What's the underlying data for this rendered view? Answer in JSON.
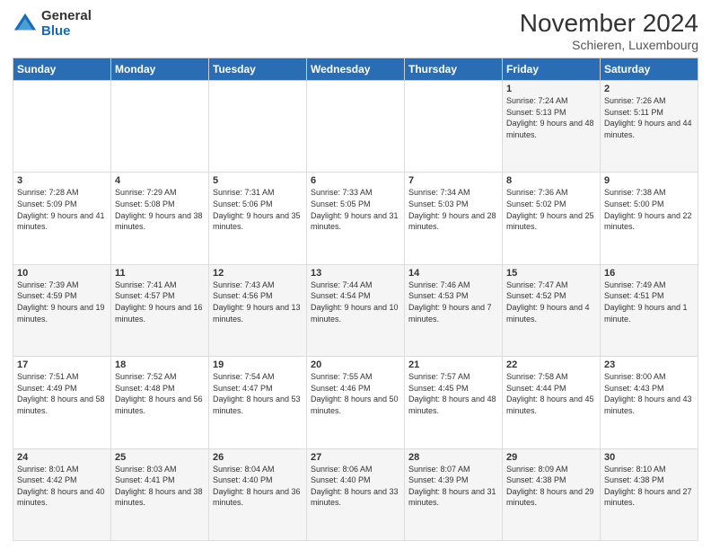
{
  "logo": {
    "general": "General",
    "blue": "Blue"
  },
  "header": {
    "title": "November 2024",
    "location": "Schieren, Luxembourg"
  },
  "days_of_week": [
    "Sunday",
    "Monday",
    "Tuesday",
    "Wednesday",
    "Thursday",
    "Friday",
    "Saturday"
  ],
  "weeks": [
    [
      {
        "day": "",
        "info": ""
      },
      {
        "day": "",
        "info": ""
      },
      {
        "day": "",
        "info": ""
      },
      {
        "day": "",
        "info": ""
      },
      {
        "day": "",
        "info": ""
      },
      {
        "day": "1",
        "info": "Sunrise: 7:24 AM\nSunset: 5:13 PM\nDaylight: 9 hours and 48 minutes."
      },
      {
        "day": "2",
        "info": "Sunrise: 7:26 AM\nSunset: 5:11 PM\nDaylight: 9 hours and 44 minutes."
      }
    ],
    [
      {
        "day": "3",
        "info": "Sunrise: 7:28 AM\nSunset: 5:09 PM\nDaylight: 9 hours and 41 minutes."
      },
      {
        "day": "4",
        "info": "Sunrise: 7:29 AM\nSunset: 5:08 PM\nDaylight: 9 hours and 38 minutes."
      },
      {
        "day": "5",
        "info": "Sunrise: 7:31 AM\nSunset: 5:06 PM\nDaylight: 9 hours and 35 minutes."
      },
      {
        "day": "6",
        "info": "Sunrise: 7:33 AM\nSunset: 5:05 PM\nDaylight: 9 hours and 31 minutes."
      },
      {
        "day": "7",
        "info": "Sunrise: 7:34 AM\nSunset: 5:03 PM\nDaylight: 9 hours and 28 minutes."
      },
      {
        "day": "8",
        "info": "Sunrise: 7:36 AM\nSunset: 5:02 PM\nDaylight: 9 hours and 25 minutes."
      },
      {
        "day": "9",
        "info": "Sunrise: 7:38 AM\nSunset: 5:00 PM\nDaylight: 9 hours and 22 minutes."
      }
    ],
    [
      {
        "day": "10",
        "info": "Sunrise: 7:39 AM\nSunset: 4:59 PM\nDaylight: 9 hours and 19 minutes."
      },
      {
        "day": "11",
        "info": "Sunrise: 7:41 AM\nSunset: 4:57 PM\nDaylight: 9 hours and 16 minutes."
      },
      {
        "day": "12",
        "info": "Sunrise: 7:43 AM\nSunset: 4:56 PM\nDaylight: 9 hours and 13 minutes."
      },
      {
        "day": "13",
        "info": "Sunrise: 7:44 AM\nSunset: 4:54 PM\nDaylight: 9 hours and 10 minutes."
      },
      {
        "day": "14",
        "info": "Sunrise: 7:46 AM\nSunset: 4:53 PM\nDaylight: 9 hours and 7 minutes."
      },
      {
        "day": "15",
        "info": "Sunrise: 7:47 AM\nSunset: 4:52 PM\nDaylight: 9 hours and 4 minutes."
      },
      {
        "day": "16",
        "info": "Sunrise: 7:49 AM\nSunset: 4:51 PM\nDaylight: 9 hours and 1 minute."
      }
    ],
    [
      {
        "day": "17",
        "info": "Sunrise: 7:51 AM\nSunset: 4:49 PM\nDaylight: 8 hours and 58 minutes."
      },
      {
        "day": "18",
        "info": "Sunrise: 7:52 AM\nSunset: 4:48 PM\nDaylight: 8 hours and 56 minutes."
      },
      {
        "day": "19",
        "info": "Sunrise: 7:54 AM\nSunset: 4:47 PM\nDaylight: 8 hours and 53 minutes."
      },
      {
        "day": "20",
        "info": "Sunrise: 7:55 AM\nSunset: 4:46 PM\nDaylight: 8 hours and 50 minutes."
      },
      {
        "day": "21",
        "info": "Sunrise: 7:57 AM\nSunset: 4:45 PM\nDaylight: 8 hours and 48 minutes."
      },
      {
        "day": "22",
        "info": "Sunrise: 7:58 AM\nSunset: 4:44 PM\nDaylight: 8 hours and 45 minutes."
      },
      {
        "day": "23",
        "info": "Sunrise: 8:00 AM\nSunset: 4:43 PM\nDaylight: 8 hours and 43 minutes."
      }
    ],
    [
      {
        "day": "24",
        "info": "Sunrise: 8:01 AM\nSunset: 4:42 PM\nDaylight: 8 hours and 40 minutes."
      },
      {
        "day": "25",
        "info": "Sunrise: 8:03 AM\nSunset: 4:41 PM\nDaylight: 8 hours and 38 minutes."
      },
      {
        "day": "26",
        "info": "Sunrise: 8:04 AM\nSunset: 4:40 PM\nDaylight: 8 hours and 36 minutes."
      },
      {
        "day": "27",
        "info": "Sunrise: 8:06 AM\nSunset: 4:40 PM\nDaylight: 8 hours and 33 minutes."
      },
      {
        "day": "28",
        "info": "Sunrise: 8:07 AM\nSunset: 4:39 PM\nDaylight: 8 hours and 31 minutes."
      },
      {
        "day": "29",
        "info": "Sunrise: 8:09 AM\nSunset: 4:38 PM\nDaylight: 8 hours and 29 minutes."
      },
      {
        "day": "30",
        "info": "Sunrise: 8:10 AM\nSunset: 4:38 PM\nDaylight: 8 hours and 27 minutes."
      }
    ]
  ]
}
